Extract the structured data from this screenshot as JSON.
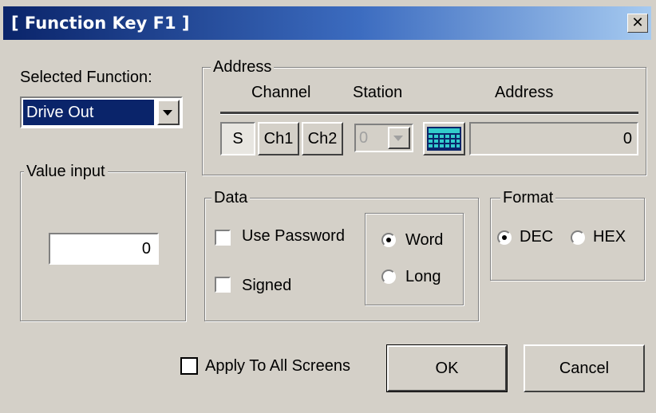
{
  "window": {
    "title": "[ Function Key F1 ]",
    "close_glyph": "✕"
  },
  "selected_function": {
    "label": "Selected Function:",
    "value": "Drive Out"
  },
  "value_input": {
    "label": "Value input",
    "value": "0"
  },
  "address": {
    "group_label": "Address",
    "columns": {
      "channel": "Channel",
      "station": "Station",
      "address": "Address"
    },
    "buttons": [
      "S",
      "Ch1",
      "Ch2"
    ],
    "station_value": "0",
    "address_value": "0",
    "grid_icon": "keypad-grid-icon"
  },
  "data": {
    "group_label": "Data",
    "use_password_label": "Use Password",
    "signed_label": "Signed",
    "word_label": "Word",
    "long_label": "Long",
    "selected_size": "Word"
  },
  "format": {
    "group_label": "Format",
    "dec_label": "DEC",
    "hex_label": "HEX",
    "selected": "DEC"
  },
  "footer": {
    "apply_all_label": "Apply To All Screens",
    "ok_label": "OK",
    "cancel_label": "Cancel"
  },
  "colors": {
    "title_start": "#0a246a",
    "title_end": "#a6caf0",
    "selection": "#0a246a",
    "face": "#d4d0c8"
  }
}
